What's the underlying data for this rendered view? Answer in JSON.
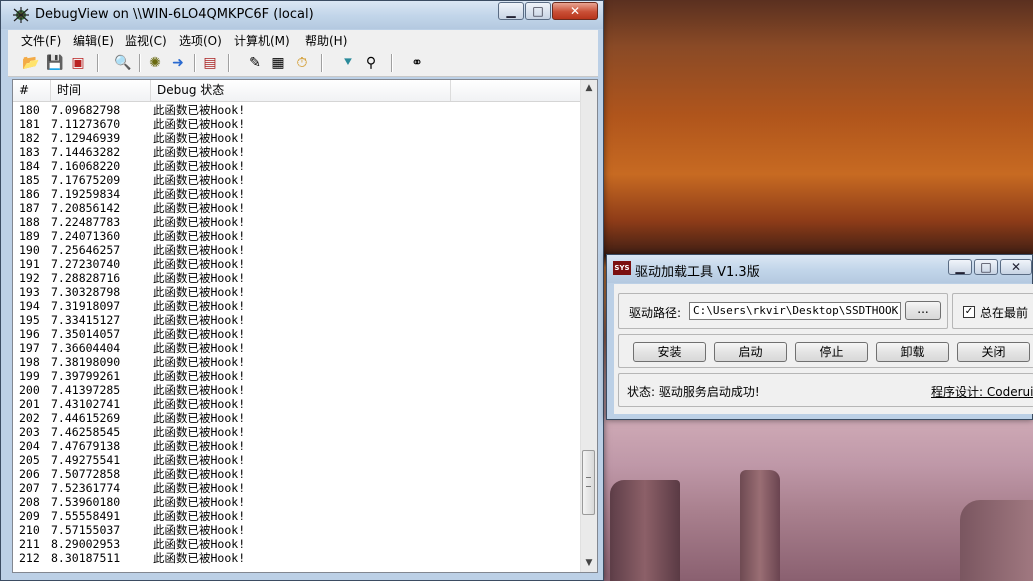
{
  "debugview": {
    "title": "DebugView on \\\\WIN-6LO4QMKPC6F (local)",
    "menus": [
      "文件(F)",
      "编辑(E)",
      "监视(C)",
      "选项(O)",
      "计算机(M)",
      "帮助(H)"
    ],
    "toolbar_icons": [
      "open-icon",
      "save-icon",
      "clear-icon",
      "find-icon",
      "capture-icon",
      "autoscroll-icon",
      "clear-display-icon",
      "filter-icon",
      "history-icon",
      "time-icon",
      "highlight-icon",
      "pin-icon",
      "search-binoculars-icon"
    ],
    "columns": [
      "#",
      "时间",
      "Debug 状态"
    ],
    "rows": [
      {
        "num": "180",
        "time": "7.09682798",
        "msg": "此函数已被Hook!"
      },
      {
        "num": "181",
        "time": "7.11273670",
        "msg": "此函数已被Hook!"
      },
      {
        "num": "182",
        "time": "7.12946939",
        "msg": "此函数已被Hook!"
      },
      {
        "num": "183",
        "time": "7.14463282",
        "msg": "此函数已被Hook!"
      },
      {
        "num": "184",
        "time": "7.16068220",
        "msg": "此函数已被Hook!"
      },
      {
        "num": "185",
        "time": "7.17675209",
        "msg": "此函数已被Hook!"
      },
      {
        "num": "186",
        "time": "7.19259834",
        "msg": "此函数已被Hook!"
      },
      {
        "num": "187",
        "time": "7.20856142",
        "msg": "此函数已被Hook!"
      },
      {
        "num": "188",
        "time": "7.22487783",
        "msg": "此函数已被Hook!"
      },
      {
        "num": "189",
        "time": "7.24071360",
        "msg": "此函数已被Hook!"
      },
      {
        "num": "190",
        "time": "7.25646257",
        "msg": "此函数已被Hook!"
      },
      {
        "num": "191",
        "time": "7.27230740",
        "msg": "此函数已被Hook!"
      },
      {
        "num": "192",
        "time": "7.28828716",
        "msg": "此函数已被Hook!"
      },
      {
        "num": "193",
        "time": "7.30328798",
        "msg": "此函数已被Hook!"
      },
      {
        "num": "194",
        "time": "7.31918097",
        "msg": "此函数已被Hook!"
      },
      {
        "num": "195",
        "time": "7.33415127",
        "msg": "此函数已被Hook!"
      },
      {
        "num": "196",
        "time": "7.35014057",
        "msg": "此函数已被Hook!"
      },
      {
        "num": "197",
        "time": "7.36604404",
        "msg": "此函数已被Hook!"
      },
      {
        "num": "198",
        "time": "7.38198090",
        "msg": "此函数已被Hook!"
      },
      {
        "num": "199",
        "time": "7.39799261",
        "msg": "此函数已被Hook!"
      },
      {
        "num": "200",
        "time": "7.41397285",
        "msg": "此函数已被Hook!"
      },
      {
        "num": "201",
        "time": "7.43102741",
        "msg": "此函数已被Hook!"
      },
      {
        "num": "202",
        "time": "7.44615269",
        "msg": "此函数已被Hook!"
      },
      {
        "num": "203",
        "time": "7.46258545",
        "msg": "此函数已被Hook!"
      },
      {
        "num": "204",
        "time": "7.47679138",
        "msg": "此函数已被Hook!"
      },
      {
        "num": "205",
        "time": "7.49275541",
        "msg": "此函数已被Hook!"
      },
      {
        "num": "206",
        "time": "7.50772858",
        "msg": "此函数已被Hook!"
      },
      {
        "num": "207",
        "time": "7.52361774",
        "msg": "此函数已被Hook!"
      },
      {
        "num": "208",
        "time": "7.53960180",
        "msg": "此函数已被Hook!"
      },
      {
        "num": "209",
        "time": "7.55558491",
        "msg": "此函数已被Hook!"
      },
      {
        "num": "210",
        "time": "7.57155037",
        "msg": "此函数已被Hook!"
      },
      {
        "num": "211",
        "time": "8.29002953",
        "msg": "此函数已被Hook!"
      },
      {
        "num": "212",
        "time": "8.30187511",
        "msg": "此函数已被Hook!"
      }
    ]
  },
  "driver_tool": {
    "icon_text": "SYS",
    "title": "驱动加载工具 V1.3版",
    "path_label": "驱动路径:",
    "path_value": "C:\\Users\\rkvir\\Desktop\\SSDTHOOK.sy",
    "browse_label": "...",
    "checkbox_label": "总在最前",
    "checkbox_checked": true,
    "buttons": [
      "安装",
      "启动",
      "停止",
      "卸载",
      "关闭"
    ],
    "status": "状态: 驱动服务启动成功!",
    "credit": "程序设计: Coderui"
  }
}
